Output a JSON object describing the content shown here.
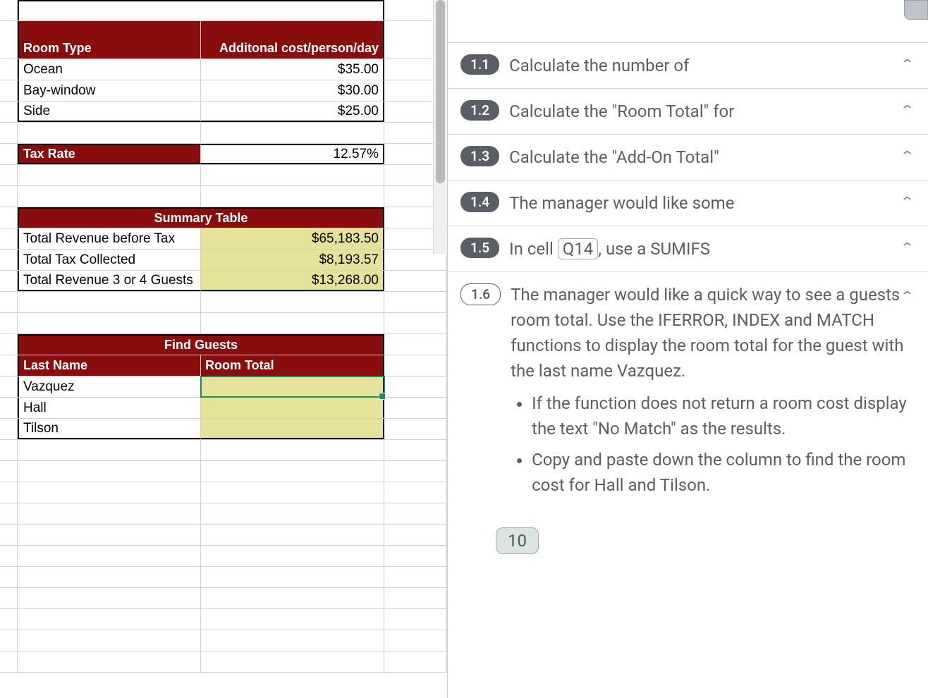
{
  "roomTypes": {
    "headerType": "Room Type",
    "headerCost": "Additonal  cost/person/day",
    "rows": [
      {
        "type": "Ocean",
        "cost": "$35.00"
      },
      {
        "type": "Bay-window",
        "cost": "$30.00"
      },
      {
        "type": "Side",
        "cost": "$25.00"
      }
    ]
  },
  "taxRate": {
    "label": "Tax Rate",
    "value": "12.57%"
  },
  "summary": {
    "title": "Summary Table",
    "rows": [
      {
        "label": "Total Revenue before Tax",
        "value": "$65,183.50"
      },
      {
        "label": "Total Tax Collected",
        "value": "$8,193.57"
      },
      {
        "label": "Total Revenue 3 or 4 Guests",
        "value": "$13,268.00"
      }
    ]
  },
  "findGuests": {
    "title": "Find Guests",
    "headerName": "Last Name",
    "headerTotal": "Room Total",
    "rows": [
      {
        "name": "Vazquez",
        "total": ""
      },
      {
        "name": "Hall",
        "total": ""
      },
      {
        "name": "Tilson",
        "total": ""
      }
    ]
  },
  "tasks": [
    {
      "num": "1.1",
      "text": "Calculate the number of",
      "filled": true
    },
    {
      "num": "1.2",
      "text": "Calculate the \"Room Total\" for",
      "filled": true
    },
    {
      "num": "1.3",
      "text": "Calculate the \"Add-On Total\"",
      "filled": true
    },
    {
      "num": "1.4",
      "text": "The manager would like some",
      "filled": true
    },
    {
      "num": "1.5",
      "textPre": "In cell ",
      "cell": "Q14",
      "textPost": ", use a SUMIFS",
      "filled": true
    }
  ],
  "expanded": {
    "num": "1.6",
    "intro": "The manager would like a quick way to see a guests room total. Use the IFERROR, INDEX and MATCH functions to display the room total for the guest with the last name Vazquez.",
    "bullets": [
      "If the function does not return a room cost display the text \"No Match\" as the results.",
      "Copy and paste down the column to find the room cost for Hall and Tilson."
    ]
  },
  "footerCount": "10"
}
